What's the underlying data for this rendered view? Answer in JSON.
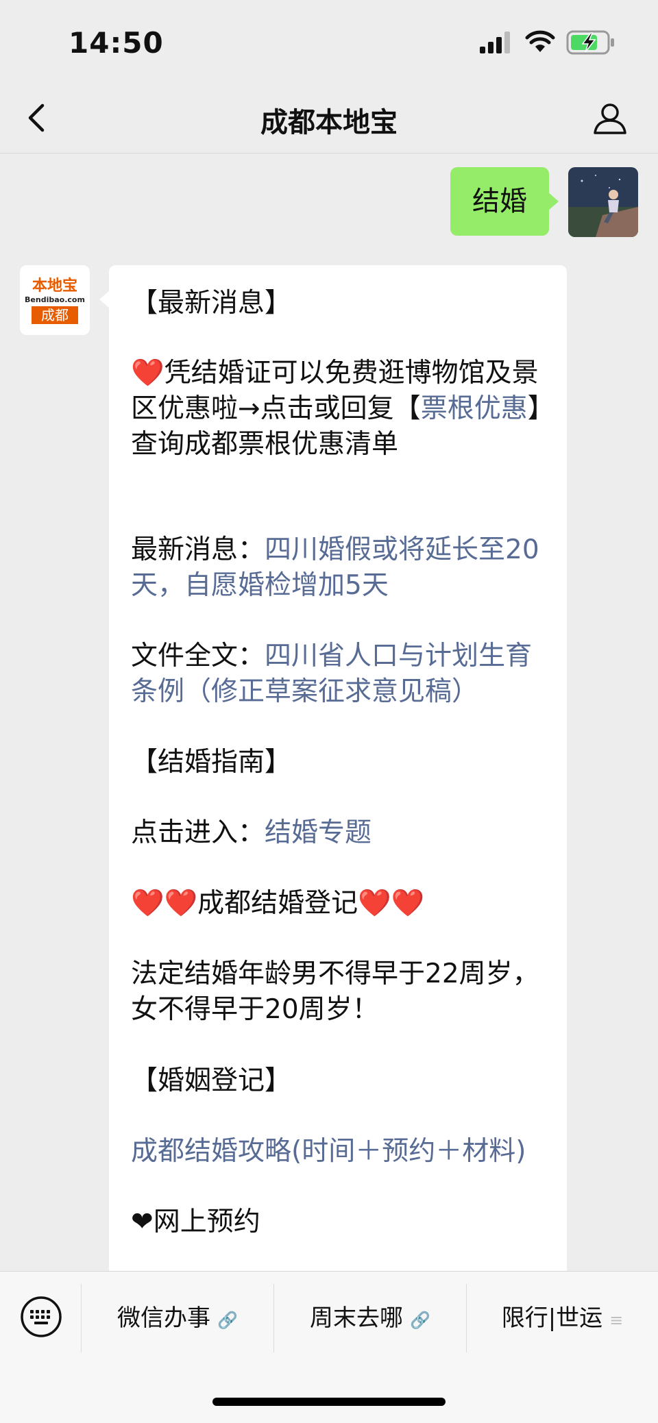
{
  "status_bar": {
    "time": "14:50"
  },
  "nav": {
    "title": "成都本地宝"
  },
  "chat": {
    "user_message": "结婚",
    "bot_avatar": {
      "logo_top": "本地宝",
      "logo_mid": "Bendibao.com",
      "logo_city": "成都"
    },
    "lines": {
      "l1": "【最新消息】",
      "l2_heart": "❤️",
      "l2_text": "凭结婚证可以免费逛博物馆及景区优惠啦→点击或回复【",
      "l2_link": "票根优惠",
      "l2_tail": "】查询成都票根优惠清单",
      "l3_label": "最新消息：",
      "l3_link": "四川婚假或将延长至20天，自愿婚检增加5天",
      "l4_label": "文件全文：",
      "l4_link": "四川省人口与计划生育条例（修正草案征求意见稿）",
      "l5": "【结婚指南】",
      "l6_label": "点击进入：",
      "l6_link": "结婚专题",
      "l7_hearts_left": "❤️❤️",
      "l7_text": "成都结婚登记",
      "l7_hearts_right": "❤️❤️",
      "l8": "法定结婚年龄男不得早于22周岁，女不得早于20周岁！",
      "l9": "【婚姻登记】",
      "l10_link": "成都结婚攻略(时间＋预约＋材料)",
      "l11_heart": "❤",
      "l11_text": "网上预约"
    }
  },
  "menu": {
    "items": [
      {
        "label": "微信办事",
        "suffix": "🔗"
      },
      {
        "label": "周末去哪",
        "suffix": "🔗"
      },
      {
        "label": "限行|世运",
        "suffix": "≡"
      }
    ]
  },
  "colors": {
    "bubble_green": "#95ec69",
    "link": "#576b95",
    "background": "#ededed"
  },
  "icons": [
    "back-icon",
    "profile-icon",
    "signal-icon",
    "wifi-icon",
    "battery-charging-icon",
    "keyboard-icon",
    "link-icon",
    "list-icon"
  ]
}
